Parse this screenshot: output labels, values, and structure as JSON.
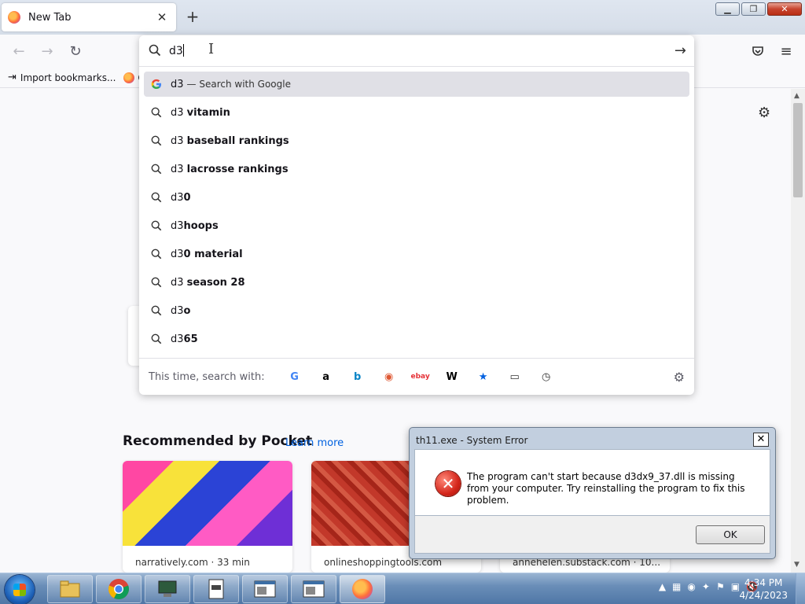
{
  "browser": {
    "tab": {
      "title": "New Tab",
      "close": "✕"
    },
    "new_tab": "+",
    "window_buttons": {
      "minimize": "▁",
      "maximize": "❐",
      "close": "✕"
    }
  },
  "toolbar": {
    "back": "←",
    "forward": "→",
    "reload": "↻",
    "pocket": "♥",
    "menu": "≡"
  },
  "bookmarks": [
    {
      "label": "Import bookmarks...",
      "icon": "import-icon"
    },
    {
      "label": "G",
      "icon": "firefox-icon"
    }
  ],
  "urlbar": {
    "typed": "d3",
    "go": "→",
    "results": [
      {
        "typed": "d3",
        "bold": "",
        "action": "— Search with Google",
        "icon": "google-icon"
      },
      {
        "typed": "d3 ",
        "bold": "vitamin",
        "action": "",
        "icon": "search-icon"
      },
      {
        "typed": "d3 ",
        "bold": "baseball rankings",
        "action": "",
        "icon": "search-icon"
      },
      {
        "typed": "d3 ",
        "bold": "lacrosse rankings",
        "action": "",
        "icon": "search-icon"
      },
      {
        "typed": "d3",
        "bold": "0",
        "action": "",
        "icon": "search-icon"
      },
      {
        "typed": "d3",
        "bold": "hoops",
        "action": "",
        "icon": "search-icon"
      },
      {
        "typed": "d3",
        "bold": "0 material",
        "action": "",
        "icon": "search-icon"
      },
      {
        "typed": "d3 ",
        "bold": "season 28",
        "action": "",
        "icon": "search-icon"
      },
      {
        "typed": "d3",
        "bold": "o",
        "action": "",
        "icon": "search-icon"
      },
      {
        "typed": "d3",
        "bold": "65",
        "action": "",
        "icon": "search-icon"
      }
    ],
    "oneoff_label": "This time, search with:",
    "engines": [
      {
        "name": "google-engine",
        "glyph": "G",
        "color": "#4285f4"
      },
      {
        "name": "amazon-engine",
        "glyph": "a",
        "color": "#000000"
      },
      {
        "name": "bing-engine",
        "glyph": "b",
        "color": "#0a84c6"
      },
      {
        "name": "duckduckgo-engine",
        "glyph": "◉",
        "color": "#de5833"
      },
      {
        "name": "ebay-engine",
        "glyph": "ebay",
        "color": "#e53238"
      },
      {
        "name": "wikipedia-engine",
        "glyph": "W",
        "color": "#000000"
      },
      {
        "name": "bookmarks-engine",
        "glyph": "★",
        "color": "#0061e0"
      },
      {
        "name": "tabs-engine",
        "glyph": "▭",
        "color": "#333333"
      },
      {
        "name": "history-engine",
        "glyph": "◷",
        "color": "#333333"
      }
    ]
  },
  "content": {
    "pocket_heading": "Recommended by Pocket",
    "learn_more": "Learn more",
    "cards": [
      {
        "source": "narratively.com · 33 min"
      },
      {
        "source": "onlineshoppingtools.com"
      },
      {
        "source": "annehelen.substack.com · 10..."
      }
    ]
  },
  "dialog": {
    "title": "th11.exe - System Error",
    "close": "✕",
    "message": "The program can't start because d3dx9_37.dll is missing from your computer. Try reinstalling the program to fix this problem.",
    "ok": "OK"
  },
  "taskbar": {
    "apps": [
      "explorer",
      "chrome",
      "pc",
      "document",
      "window-1",
      "window-2",
      "firefox"
    ],
    "time": "4:34 PM",
    "date": "4/24/2023"
  }
}
